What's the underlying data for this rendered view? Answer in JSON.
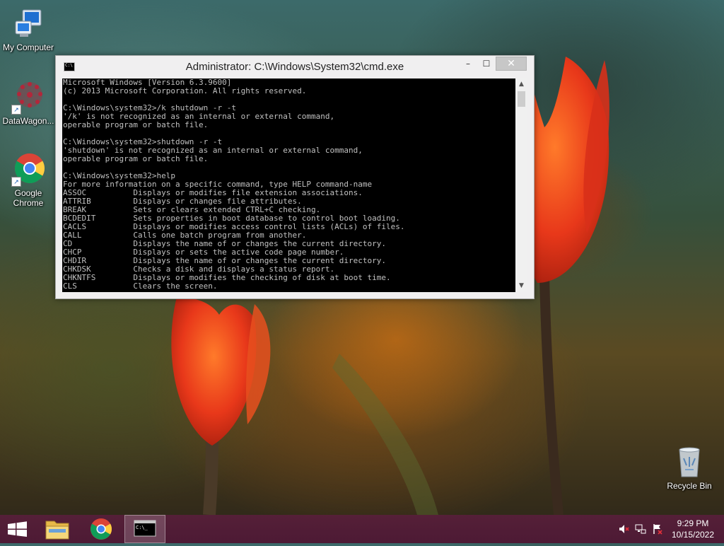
{
  "desktop": {
    "icons": [
      {
        "label": "My Computer"
      },
      {
        "label": "DataWagon..."
      },
      {
        "label": "Google Chrome"
      },
      {
        "label": "Recycle Bin"
      }
    ]
  },
  "window": {
    "title": "Administrator: C:\\Windows\\System32\\cmd.exe",
    "minimize_glyph": "–",
    "maximize_glyph": "☐",
    "close_glyph": "✕",
    "console_lines": [
      "Microsoft Windows [Version 6.3.9600]",
      "(c) 2013 Microsoft Corporation. All rights reserved.",
      "",
      "C:\\Windows\\system32>/k shutdown -r -t",
      "'/k' is not recognized as an internal or external command,",
      "operable program or batch file.",
      "",
      "C:\\Windows\\system32>shutdown -r -t",
      "'shutdown' is not recognized as an internal or external command,",
      "operable program or batch file.",
      "",
      "C:\\Windows\\system32>help",
      "For more information on a specific command, type HELP command-name",
      "ASSOC          Displays or modifies file extension associations.",
      "ATTRIB         Displays or changes file attributes.",
      "BREAK          Sets or clears extended CTRL+C checking.",
      "BCDEDIT        Sets properties in boot database to control boot loading.",
      "CACLS          Displays or modifies access control lists (ACLs) of files.",
      "CALL           Calls one batch program from another.",
      "CD             Displays the name of or changes the current directory.",
      "CHCP           Displays or sets the active code page number.",
      "CHDIR          Displays the name of or changes the current directory.",
      "CHKDSK         Checks a disk and displays a status report.",
      "CHKNTFS        Displays or modifies the checking of disk at boot time.",
      "CLS            Clears the screen."
    ]
  },
  "taskbar": {
    "items": [
      {
        "icon": "windows-start-icon"
      },
      {
        "icon": "file-explorer-icon"
      },
      {
        "icon": "chrome-icon"
      },
      {
        "icon": "cmd-icon"
      }
    ],
    "tray": {
      "volume_icon": "speaker-muted-icon",
      "network_icon": "network-icon",
      "flag_icon": "action-center-flag-icon"
    },
    "clock": {
      "time": "9:29 PM",
      "date": "10/15/2022"
    }
  },
  "colors": {
    "console_bg": "#000000",
    "console_fg": "#c0c0c0",
    "taskbar": "#5a1e3c",
    "window_frame": "#f0eff0"
  }
}
